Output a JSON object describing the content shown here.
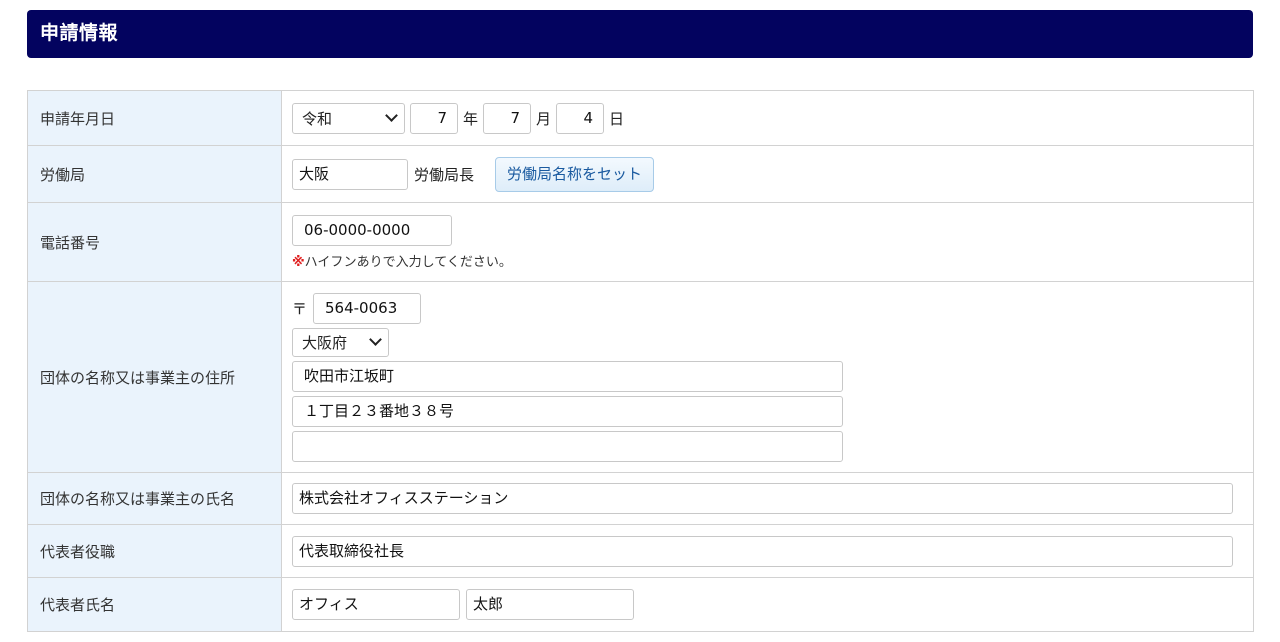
{
  "header": {
    "title": "申請情報"
  },
  "rows": {
    "date": {
      "label": "申請年月日",
      "era": "令和",
      "year": "7",
      "year_unit": "年",
      "month": "7",
      "month_unit": "月",
      "day": "4",
      "day_unit": "日"
    },
    "bureau": {
      "label": "労働局",
      "value": "大阪",
      "suffix": "労働局長",
      "button": "労働局名称をセット"
    },
    "phone": {
      "label": "電話番号",
      "value": "06-0000-0000",
      "note_mark": "※",
      "note": "ハイフンありで入力してください。"
    },
    "address": {
      "label": "団体の名称又は事業主の住所",
      "postal_mark": "〒",
      "postal_code": "564-0063",
      "prefecture": "大阪府",
      "line1": "吹田市江坂町",
      "line2": "１丁目２３番地３８号",
      "line3": ""
    },
    "name": {
      "label": "団体の名称又は事業主の氏名",
      "value": "株式会社オフィスステーション"
    },
    "rep_title": {
      "label": "代表者役職",
      "value": "代表取締役社長"
    },
    "rep_name": {
      "label": "代表者氏名",
      "last": "オフィス",
      "first": "太郎"
    }
  },
  "colors": {
    "header_bg": "#03035f",
    "label_bg": "#eaf3fc",
    "button_text": "#1a5aa0",
    "note_mark": "#e02020"
  }
}
